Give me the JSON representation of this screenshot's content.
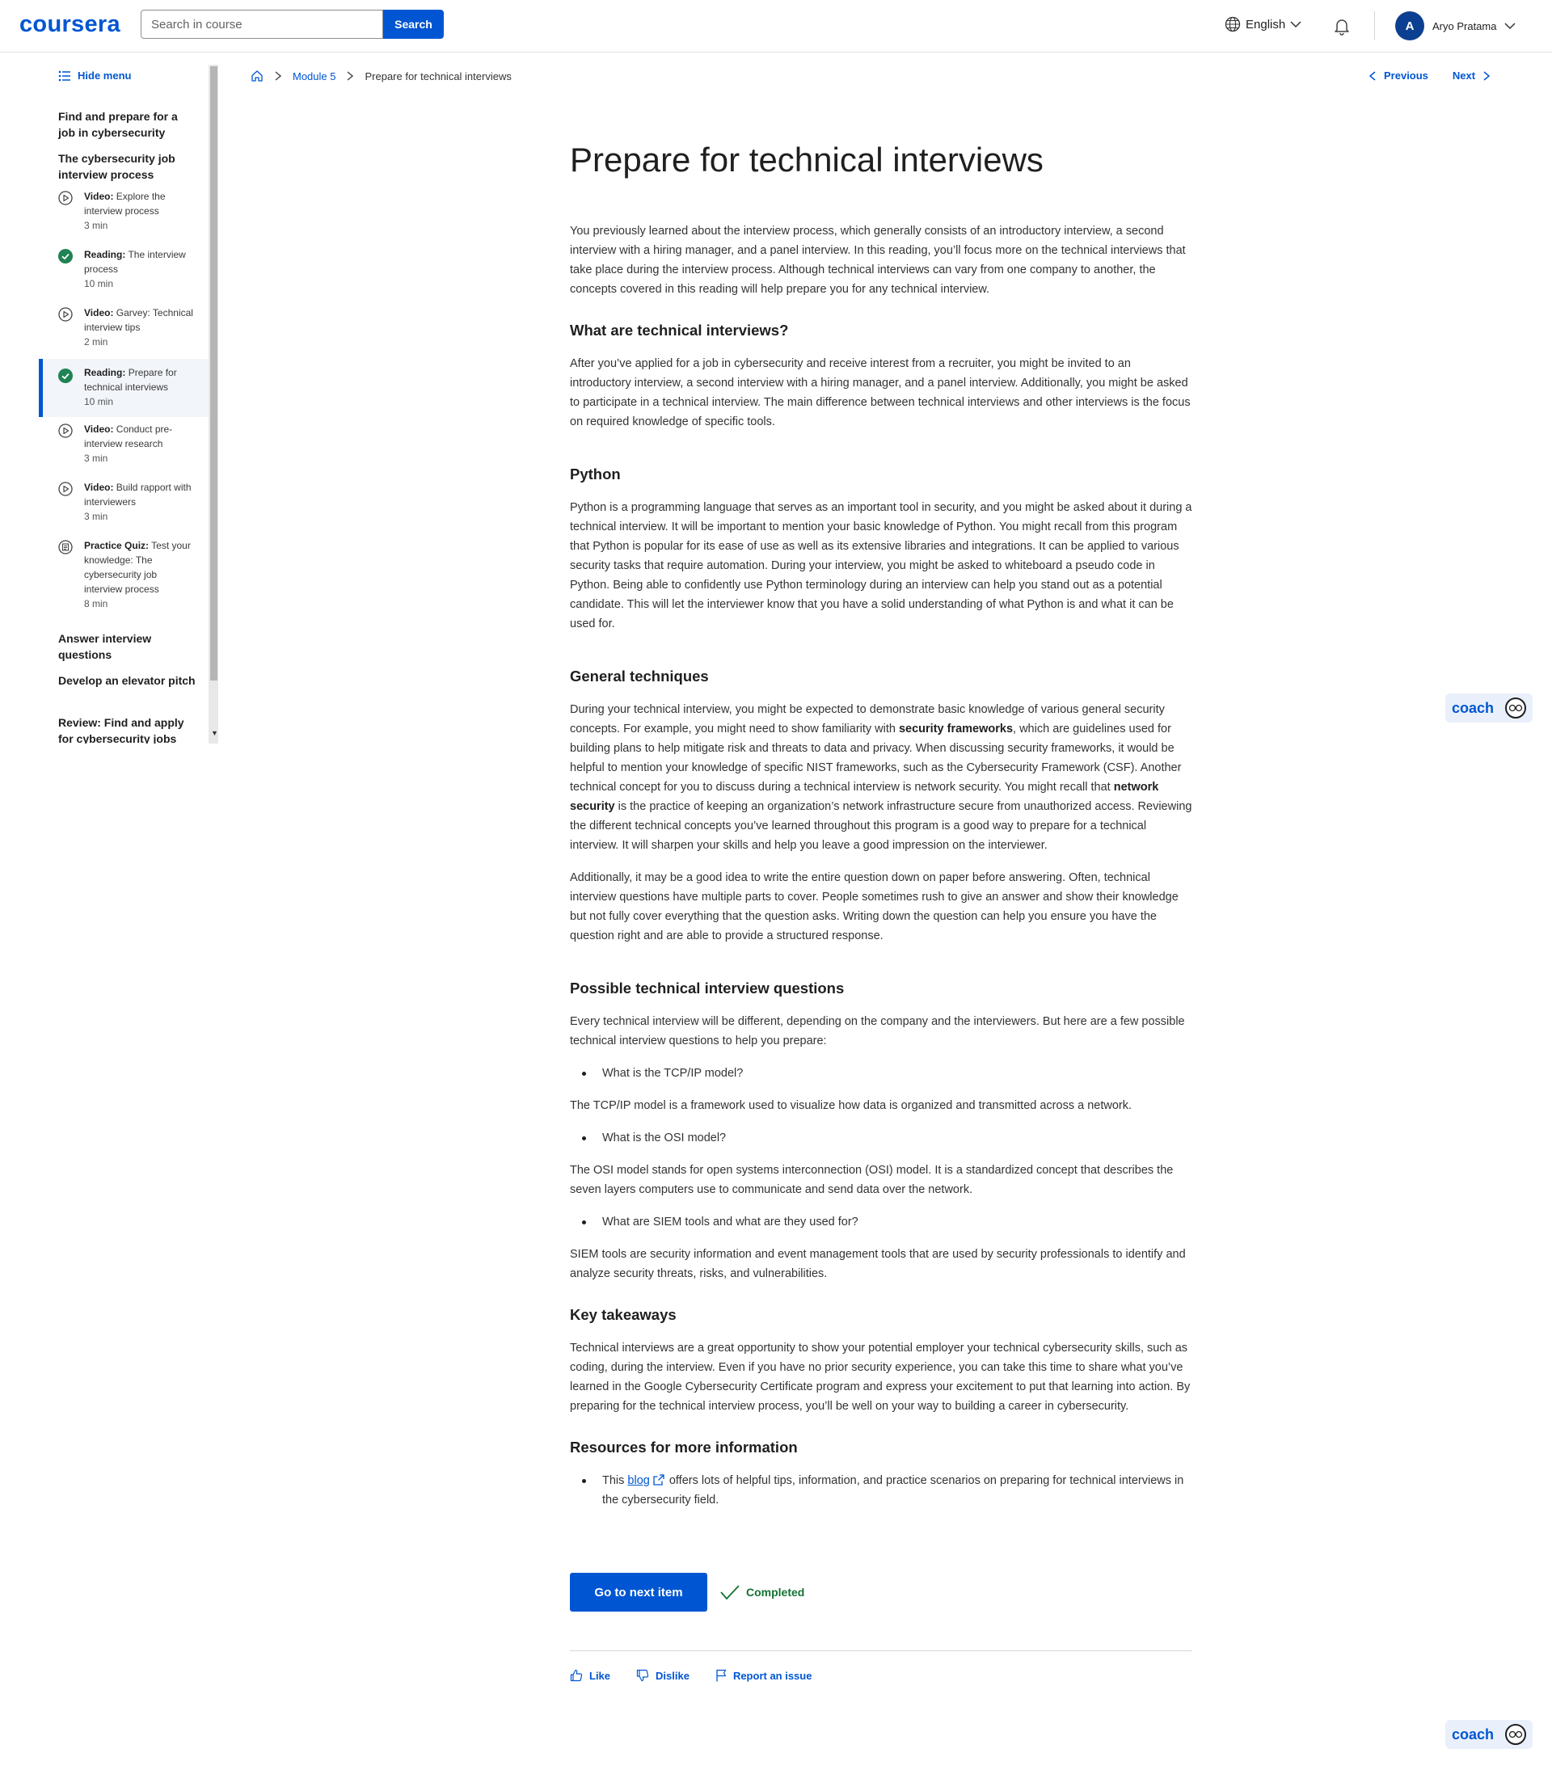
{
  "header": {
    "logo": "coursera",
    "search_placeholder": "Search in course",
    "search_button": "Search",
    "language": "English",
    "user_initial": "A",
    "user_name": "Aryo Pratama"
  },
  "sidebar": {
    "hide_menu": "Hide menu",
    "sections": [
      "Find and prepare for a job in cybersecurity",
      "The cybersecurity job interview process"
    ],
    "items": [
      {
        "type": "Video:",
        "title": "Explore the interview process",
        "duration": "3 min",
        "status": "video"
      },
      {
        "type": "Reading:",
        "title": "The interview process",
        "duration": "10 min",
        "status": "completed"
      },
      {
        "type": "Video:",
        "title": "Garvey: Technical interview tips",
        "duration": "2 min",
        "status": "video"
      },
      {
        "type": "Reading:",
        "title": "Prepare for technical interviews",
        "duration": "10 min",
        "status": "completed"
      },
      {
        "type": "Video:",
        "title": "Conduct pre-interview research",
        "duration": "3 min",
        "status": "video"
      },
      {
        "type": "Video:",
        "title": "Build rapport with interviewers",
        "duration": "3 min",
        "status": "video"
      },
      {
        "type": "Practice Quiz:",
        "title": "Test your knowledge: The cybersecurity job interview process",
        "duration": "8 min",
        "status": "quiz"
      }
    ],
    "more_sections": [
      "Answer interview questions",
      "Develop an elevator pitch",
      "Review: Find and apply for cybersecurity jobs"
    ]
  },
  "breadcrumb": {
    "module": "Module 5",
    "current": "Prepare for technical interviews"
  },
  "nav": {
    "previous": "Previous",
    "next": "Next"
  },
  "article": {
    "title": "Prepare for technical interviews",
    "intro": "You previously learned about the interview process, which generally consists of an introductory interview, a second interview with a hiring manager, and a panel interview. In this reading, you’ll focus more on the technical interviews that take place during the interview process. Although technical interviews can vary from one company to another, the concepts covered in this reading will help prepare you for any technical interview.",
    "h_what": "What are technical interviews?",
    "p_what": "After you’ve applied for a job in cybersecurity and receive interest from a recruiter, you might be invited to an introductory interview, a second interview with a hiring manager, and a panel interview. Additionally, you might be asked to participate in a technical interview. The main difference between technical interviews and other interviews is the focus on required knowledge of specific tools.",
    "h_python": "Python",
    "p_python": "Python is a programming language that serves as an important tool in security, and you might be asked about it during a technical interview. It will be important to mention your basic knowledge of Python. You might recall from this program that Python is popular for its ease of use as well as its extensive libraries and integrations. It can be applied to various security tasks that require automation. During your interview, you might be asked to whiteboard a pseudo code in Python. Being able to confidently use Python terminology during an interview can help you stand out as a potential candidate. This will let the interviewer know that you have a solid understanding of what Python is and what it can be used for.",
    "h_general": "General techniques",
    "p_general_1": "During your technical interview, you might be expected to demonstrate basic knowledge of various general security concepts. For example, you might need to show familiarity with ",
    "p_general_bold_1": "security frameworks",
    "p_general_2": ", which are guidelines used for building plans to help mitigate risk and threats to data and privacy. When discussing security frameworks, it would be helpful to mention your knowledge of specific NIST frameworks, such as the Cybersecurity Framework (CSF). Another technical concept for you to discuss during a technical interview is network security. You might recall that ",
    "p_general_bold_2": "network security",
    "p_general_3": " is the practice of keeping an organization’s network infrastructure secure from unauthorized access. Reviewing the different technical concepts you’ve learned throughout this program is a good way to prepare for a technical interview. It will sharpen your skills and help you leave a good impression on the interviewer.",
    "p_additionally": "Additionally, it may be a good idea to write the entire question down on paper before answering. Often, technical interview questions have multiple parts to cover. People sometimes rush to give an answer and show their knowledge but not fully cover everything that the question asks. Writing down the question can help you ensure you have the question right and are able to provide a structured response.",
    "h_questions": "Possible technical interview questions",
    "p_questions": "Every technical interview will be different, depending on the company and the interviewers. But here are a few possible technical interview questions to help you prepare:",
    "q1": "What is the TCP/IP model?",
    "a1": "The TCP/IP model is a framework used to visualize how data is organized and transmitted across a network.",
    "q2": "What is the OSI model?",
    "a2": "The OSI model stands for open systems interconnection (OSI) model. It is a standardized concept that describes the seven layers computers use to communicate and send data over the network.",
    "q3": "What are SIEM tools and what are they used for?",
    "a3": "SIEM tools are security information and event management tools that are used by security professionals to identify and analyze security threats, risks, and vulnerabilities.",
    "h_takeaways": "Key takeaways",
    "p_takeaways": "Technical interviews are a great opportunity to show your potential employer your technical cybersecurity skills, such as coding, during the interview. Even if you have no prior security experience, you can take this time to share what you’ve learned in the Google Cybersecurity Certificate program and express your excitement to put that learning into action. By preparing for the technical interview process, you’ll be well on your way to building a career in cybersecurity.",
    "h_resources": "Resources for more information",
    "res_pre": "This ",
    "res_link": "blog",
    "res_post": "offers lots of helpful tips, information, and practice scenarios on preparing for technical interviews in the cybersecurity field."
  },
  "actions": {
    "next_item": "Go to next item",
    "completed": "Completed"
  },
  "feedback": {
    "like": "Like",
    "dislike": "Dislike",
    "report": "Report an issue"
  },
  "coach": {
    "label": "coach"
  },
  "colors": {
    "accent": "#0056d2",
    "success": "#1f8354",
    "text": "#1f1f1f"
  }
}
